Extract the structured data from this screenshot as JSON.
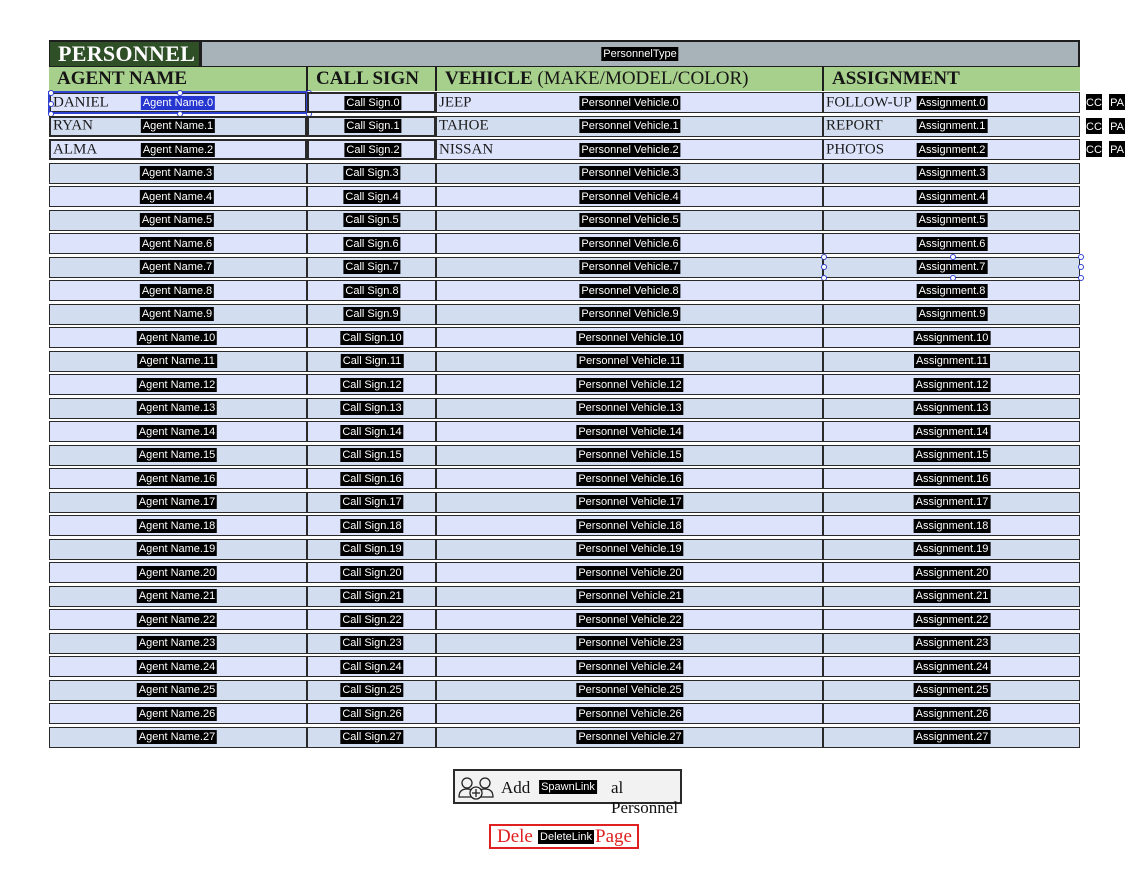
{
  "form": {
    "title": "PERSONNEL",
    "type_field_tag": "PersonnelType",
    "columns": {
      "agent": "AGENT NAME",
      "call": "CALL SIGN",
      "vehicle_bold": "VEHICLE",
      "vehicle_rest": " (MAKE/MODEL/COLOR)",
      "assignment": "ASSIGNMENT"
    },
    "rows": [
      {
        "agent": "DANIEL",
        "call": "",
        "vehicle": "JEEP",
        "assignment": "FOLLOW-UP"
      },
      {
        "agent": "RYAN",
        "call": "",
        "vehicle": "TAHOE",
        "assignment": "REPORT"
      },
      {
        "agent": "ALMA",
        "call": "",
        "vehicle": "NISSAN",
        "assignment": "PHOTOS"
      }
    ],
    "row_count": 28,
    "field_prefixes": {
      "agent": "Agent Name",
      "call": "Call Sign",
      "vehicle": "Personnel Vehicle",
      "assignment": "Assignment"
    },
    "side_buttons": [
      "CC",
      "PA"
    ]
  },
  "buttons": {
    "add_left": "Add ",
    "add_tag": "SpawnLink",
    "add_right": "al Personnel",
    "delete_left": "Dele",
    "delete_tag": "DeleteLink",
    "delete_right": "Page"
  },
  "colors": {
    "header_green": "#a8d08d",
    "title_dark_green": "#2f4f27",
    "row_blue": "#dde3fb",
    "row_alt": "#d3ddf0",
    "delete_red": "#e02020",
    "selection_blue": "#3040d0"
  },
  "icons": {
    "add_personnel": "add-group-icon"
  }
}
